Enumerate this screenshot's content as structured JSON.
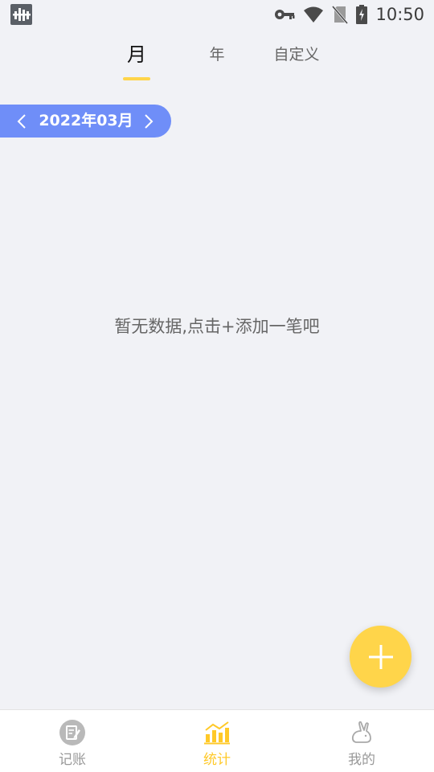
{
  "status_bar": {
    "time": "10:50",
    "icons": [
      "app-logo-icon",
      "vpn-key-icon",
      "wifi-icon",
      "no-sim-icon",
      "battery-charging-icon"
    ]
  },
  "tabs": [
    {
      "label": "月",
      "active": true
    },
    {
      "label": "年",
      "active": false
    },
    {
      "label": "自定义",
      "active": false
    }
  ],
  "month_selector": {
    "label": "2022年03月",
    "prev_icon": "chevron-left-icon",
    "next_icon": "chevron-right-icon"
  },
  "empty_state": {
    "message": "暂无数据,点击+添加一笔吧"
  },
  "fab": {
    "icon": "plus-icon"
  },
  "bottom_nav": [
    {
      "label": "记账",
      "icon": "notebook-icon",
      "active": false
    },
    {
      "label": "统计",
      "icon": "bar-chart-icon",
      "active": true
    },
    {
      "label": "我的",
      "icon": "rabbit-icon",
      "active": false
    }
  ],
  "colors": {
    "background": "#f1f2f6",
    "accent_yellow": "#ffd54a",
    "pill_blue": "#6f8ef8",
    "active_nav": "#ffc928",
    "inactive_nav": "#b5b5b5"
  }
}
